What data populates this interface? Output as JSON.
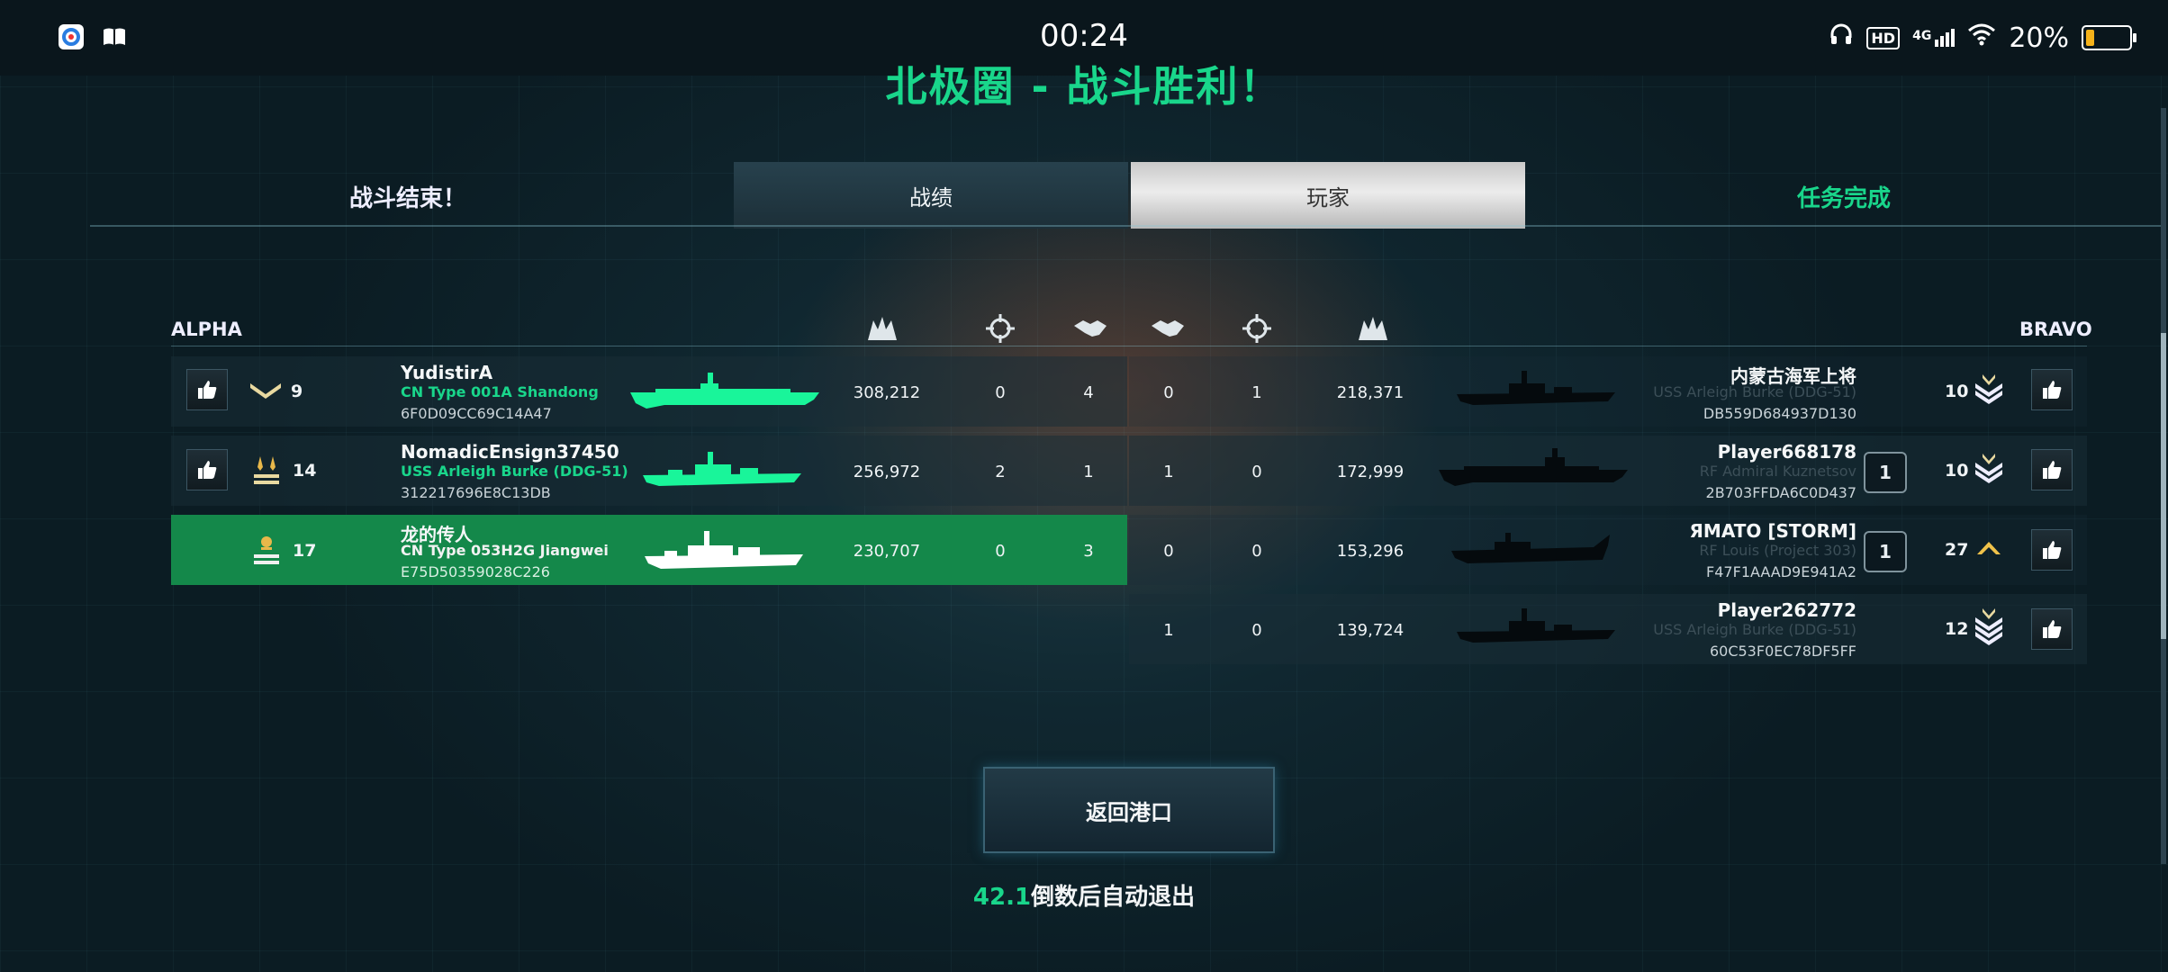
{
  "status_bar": {
    "time": "00:24",
    "hd": "HD",
    "network": "4G",
    "battery": "20%",
    "battery_level": 0.2
  },
  "title": "北极圈 - 战斗胜利！",
  "tabs": {
    "left_label": "战斗结束！",
    "stats": "战绩",
    "players": "玩家",
    "right_label": "任务完成"
  },
  "teams": {
    "alpha": "ALPHA",
    "bravo": "BRAVO"
  },
  "header_icons": [
    "damage-icon",
    "kills-icon",
    "assists-icon",
    "assists-icon",
    "kills-icon",
    "damage-icon"
  ],
  "alpha_rows": [
    {
      "rank": "9",
      "name": "YudistirA",
      "ship": "CN Type 001A Shandong",
      "id": "6F0D09CC69C14A47",
      "damage": "308,212",
      "kills": "0",
      "assists": "4",
      "ship_color": "#19f59a"
    },
    {
      "rank": "14",
      "name": "NomadicEnsign37450",
      "ship": "USS Arleigh Burke (DDG-51)",
      "id": "312217696E8C13DB",
      "damage": "256,972",
      "kills": "2",
      "assists": "1",
      "ship_color": "#19f59a"
    },
    {
      "rank": "17",
      "name": "龙的传人",
      "ship": "CN Type 053H2G Jiangwei",
      "id": "E75D50359028C226",
      "damage": "230,707",
      "kills": "0",
      "assists": "3",
      "ship_color": "#ffffff"
    }
  ],
  "bravo_rows": [
    {
      "rank": "10",
      "name": "内蒙古海军上将",
      "ship": "USS Arleigh Burke (DDG-51)",
      "id": "DB559D684937D130",
      "damage": "218,371",
      "kills": "1",
      "assists": "0",
      "badge": ""
    },
    {
      "rank": "10",
      "name": "Player668178",
      "ship": "RF Admiral Kuznetsov",
      "id": "2B703FFDA6C0D437",
      "damage": "172,999",
      "kills": "0",
      "assists": "1",
      "badge": "1"
    },
    {
      "rank": "27",
      "name": "ЯMATO [STORM]",
      "ship": "RF Louis (Project 303)",
      "id": "F47F1AAAD9E941A2",
      "damage": "153,296",
      "kills": "0",
      "assists": "0",
      "badge": "1"
    },
    {
      "rank": "12",
      "name": "Player262772",
      "ship": "USS Arleigh Burke (DDG-51)",
      "id": "60C53F0EC78DF5FF",
      "damage": "139,724",
      "kills": "0",
      "assists": "1",
      "badge": ""
    }
  ],
  "return_button": "返回港口",
  "countdown": {
    "value": "42.1",
    "text": "倒数后自动退出"
  }
}
